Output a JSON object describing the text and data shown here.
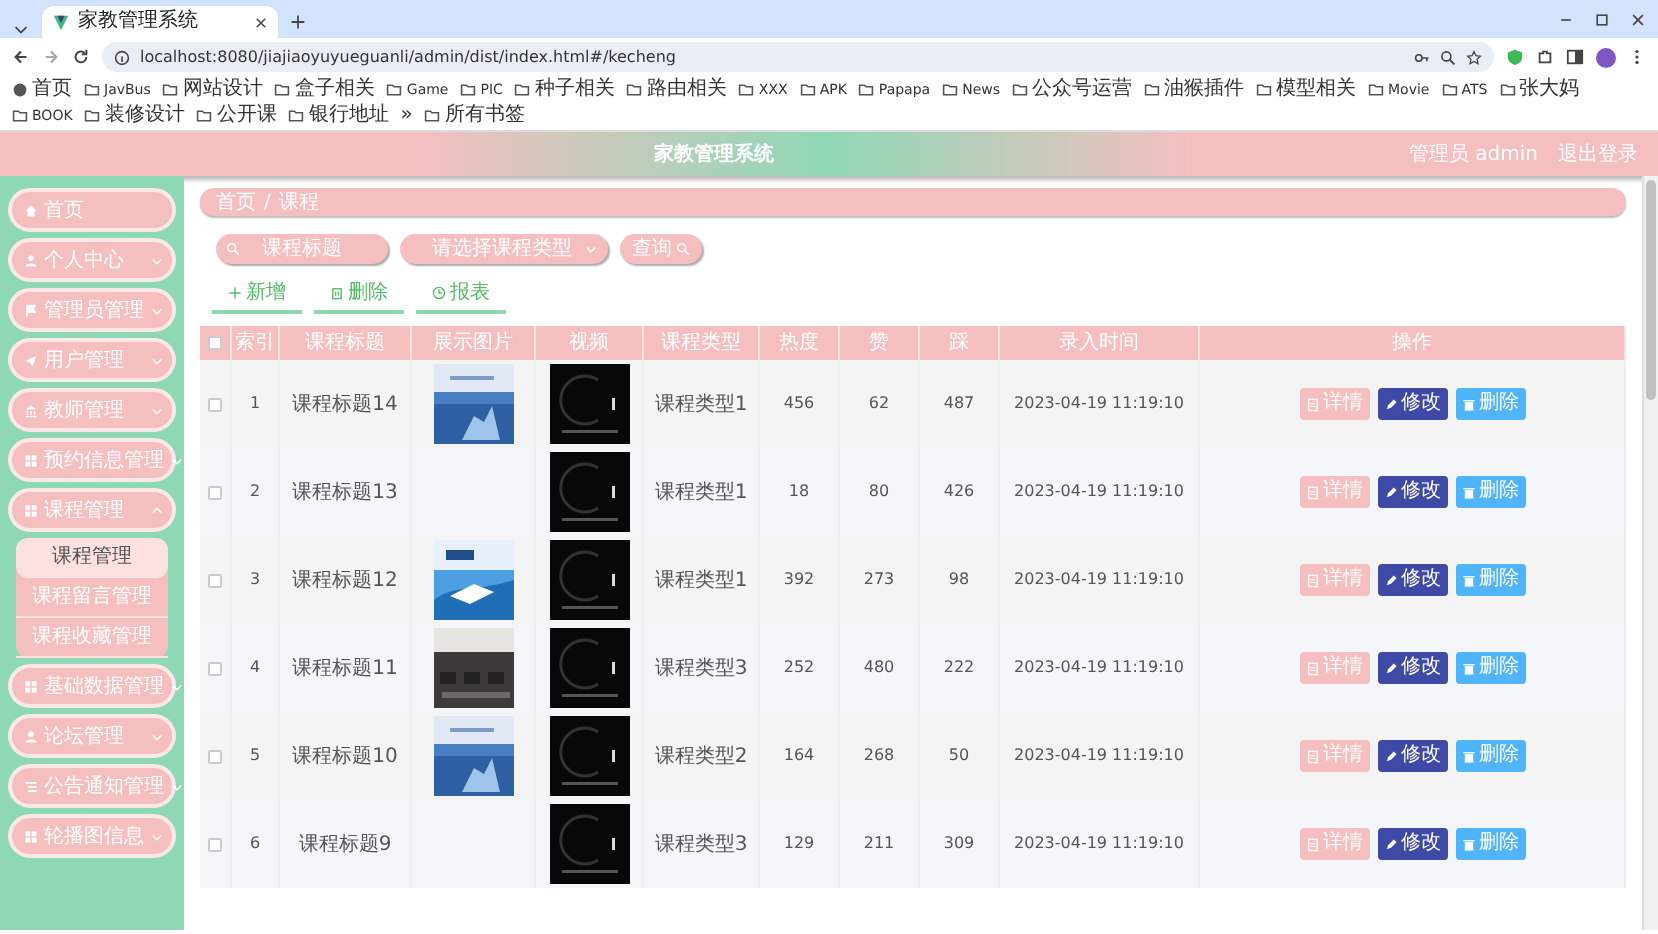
{
  "browser": {
    "tab_title": "家教管理系统",
    "url": "localhost:8080/jiajiaoyuyueguanli/admin/dist/index.html#/kecheng",
    "bookmarks": [
      "首页",
      "JavBus",
      "网站设计",
      "盒子相关",
      "Game",
      "PIC",
      "种子相关",
      "路由相关",
      "XXX",
      "APK",
      "Papapa",
      "News",
      "公众号运营",
      "油猴插件",
      "模型相关",
      "Movie",
      "ATS",
      "张大妈",
      "BOOK",
      "装修设计",
      "公开课",
      "银行地址"
    ],
    "more": "»",
    "all_bookmarks": "所有书签"
  },
  "header": {
    "title": "家教管理系统",
    "user": "管理员 admin",
    "logout": "退出登录"
  },
  "sidebar": {
    "items": [
      {
        "label": "首页"
      },
      {
        "label": "个人中心",
        "expanded": false
      },
      {
        "label": "管理员管理",
        "expanded": false
      },
      {
        "label": "用户管理",
        "expanded": false
      },
      {
        "label": "教师管理",
        "expanded": false
      },
      {
        "label": "预约信息管理",
        "expanded": false
      },
      {
        "label": "课程管理",
        "expanded": true,
        "children": [
          {
            "label": "课程管理",
            "selected": true
          },
          {
            "label": "课程留言管理",
            "selected": false
          },
          {
            "label": "课程收藏管理",
            "selected": false
          }
        ]
      },
      {
        "label": "基础数据管理",
        "expanded": false
      },
      {
        "label": "论坛管理",
        "expanded": false
      },
      {
        "label": "公告通知管理",
        "expanded": false
      },
      {
        "label": "轮播图信息",
        "expanded": false
      }
    ]
  },
  "breadcrumb": {
    "items": [
      "首页",
      "课程"
    ],
    "separator": "/"
  },
  "search": {
    "title_placeholder": "课程标题",
    "type_placeholder": "请选择课程类型",
    "button": "查询"
  },
  "toolbar": [
    "新增",
    "删除",
    "报表"
  ],
  "table": {
    "select_all_checked": false,
    "columns": [
      "索引",
      "课程标题",
      "展示图片",
      "视频",
      "课程类型",
      "热度",
      "赞",
      "踩",
      "录入时间",
      "操作"
    ],
    "rows": [
      {
        "checked": false,
        "index": "1",
        "title": "课程标题14",
        "picture": true,
        "type": "课程类型1",
        "heat": "456",
        "likes": "62",
        "dislikes": "487",
        "time": "2023-04-19 11:19:10",
        "buttons": [
          "详情",
          "修改",
          "删除"
        ]
      },
      {
        "checked": false,
        "index": "2",
        "title": "课程标题13",
        "picture": false,
        "type": "课程类型1",
        "heat": "18",
        "likes": "80",
        "dislikes": "426",
        "time": "2023-04-19 11:19:10",
        "buttons": [
          "详情",
          "修改",
          "删除"
        ]
      },
      {
        "checked": false,
        "index": "3",
        "title": "课程标题12",
        "picture": true,
        "type": "课程类型1",
        "heat": "392",
        "likes": "273",
        "dislikes": "98",
        "time": "2023-04-19 11:19:10",
        "buttons": [
          "详情",
          "修改",
          "删除"
        ]
      },
      {
        "checked": false,
        "index": "4",
        "title": "课程标题11",
        "picture": true,
        "type": "课程类型3",
        "heat": "252",
        "likes": "480",
        "dislikes": "222",
        "time": "2023-04-19 11:19:10",
        "buttons": [
          "详情",
          "修改",
          "删除"
        ]
      },
      {
        "checked": false,
        "index": "5",
        "title": "课程标题10",
        "picture": true,
        "type": "课程类型2",
        "heat": "164",
        "likes": "268",
        "dislikes": "50",
        "time": "2023-04-19 11:19:10",
        "buttons": [
          "详情",
          "修改",
          "删除"
        ]
      },
      {
        "checked": false,
        "index": "6",
        "title": "课程标题9",
        "picture": false,
        "type": "课程类型3",
        "heat": "129",
        "likes": "211",
        "dislikes": "309",
        "time": "2023-04-19 11:19:10",
        "buttons": [
          "详情",
          "修改",
          "删除"
        ]
      }
    ]
  }
}
